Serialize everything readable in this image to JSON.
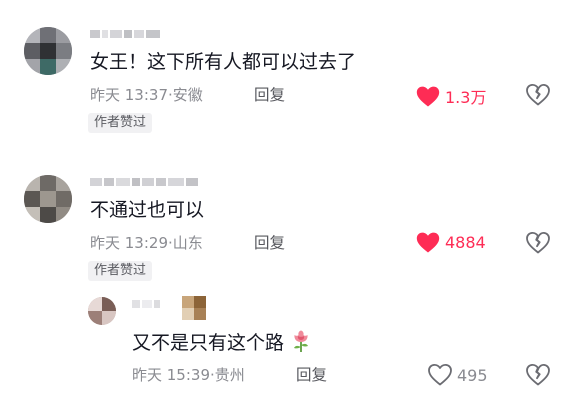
{
  "comments": [
    {
      "text": "女王！这下所有人都可以过去了",
      "time": "昨天 13:37",
      "location": "安徽",
      "reply_label": "回复",
      "badge": "作者赞过",
      "likes": "1.3万",
      "liked": true
    },
    {
      "text": "不通过也可以",
      "time": "昨天 13:29",
      "location": "山东",
      "reply_label": "回复",
      "badge": "作者赞过",
      "likes": "4884",
      "liked": true
    }
  ],
  "reply": {
    "text": "又不是只有这个路",
    "emoji": "rose",
    "time": "昨天 15:39",
    "location": "贵州",
    "reply_label": "回复",
    "likes": "495",
    "liked": false
  },
  "icons": {
    "like": "heart-icon",
    "dislike": "broken-heart-icon",
    "emoji": "rose-icon"
  },
  "colors": {
    "like_active": "#fe2c55",
    "meta_text": "#8a8b91",
    "badge_bg": "#f1f1f3"
  }
}
